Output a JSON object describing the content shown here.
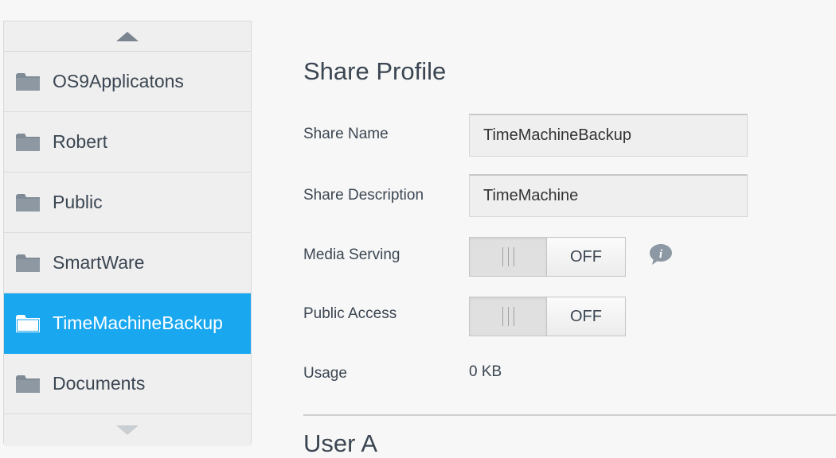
{
  "sidebar": {
    "items": [
      {
        "label": "OS9Applicatons",
        "icon": "folder-icon"
      },
      {
        "label": "Robert",
        "icon": "folder-icon"
      },
      {
        "label": "Public",
        "icon": "folder-icon"
      },
      {
        "label": "SmartWare",
        "icon": "folder-icon"
      },
      {
        "label": "TimeMachineBackup",
        "icon": "folder-icon",
        "selected": true
      },
      {
        "label": "Documents",
        "icon": "folder-icon"
      }
    ]
  },
  "profile": {
    "title": "Share Profile",
    "share_name_label": "Share Name",
    "share_name_value": "TimeMachineBackup",
    "share_description_label": "Share Description",
    "share_description_value": "TimeMachine",
    "media_serving_label": "Media Serving",
    "media_serving_state": "OFF",
    "public_access_label": "Public Access",
    "public_access_state": "OFF",
    "usage_label": "Usage",
    "usage_value": "0 KB",
    "next_section_title": "User A"
  },
  "colors": {
    "selected": "#19a7f0",
    "folder": "#7f8b96",
    "text": "#3b4652"
  }
}
